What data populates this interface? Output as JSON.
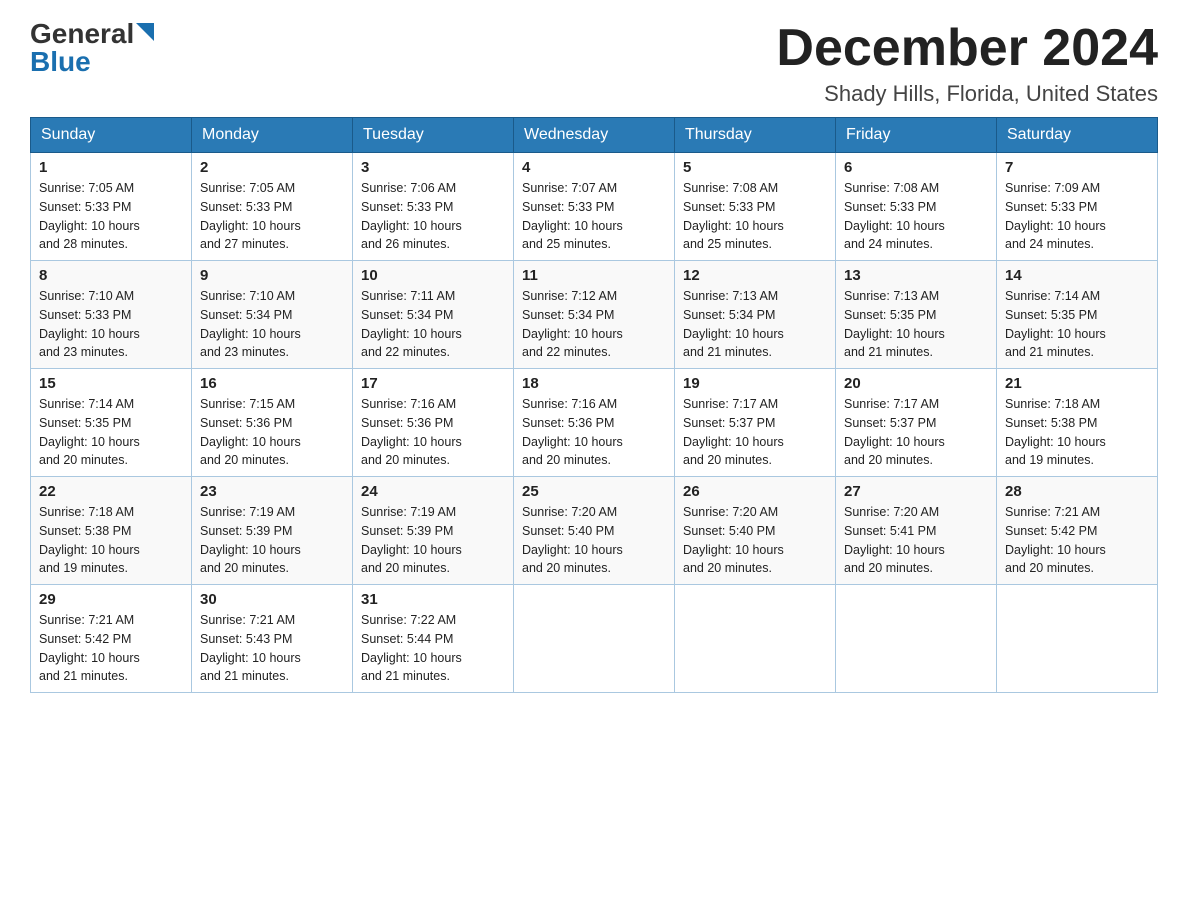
{
  "header": {
    "logo_general": "General",
    "logo_blue": "Blue",
    "month_title": "December 2024",
    "location": "Shady Hills, Florida, United States"
  },
  "days_of_week": [
    "Sunday",
    "Monday",
    "Tuesday",
    "Wednesday",
    "Thursday",
    "Friday",
    "Saturday"
  ],
  "weeks": [
    [
      {
        "day": "1",
        "sunrise": "7:05 AM",
        "sunset": "5:33 PM",
        "daylight": "10 hours and 28 minutes."
      },
      {
        "day": "2",
        "sunrise": "7:05 AM",
        "sunset": "5:33 PM",
        "daylight": "10 hours and 27 minutes."
      },
      {
        "day": "3",
        "sunrise": "7:06 AM",
        "sunset": "5:33 PM",
        "daylight": "10 hours and 26 minutes."
      },
      {
        "day": "4",
        "sunrise": "7:07 AM",
        "sunset": "5:33 PM",
        "daylight": "10 hours and 25 minutes."
      },
      {
        "day": "5",
        "sunrise": "7:08 AM",
        "sunset": "5:33 PM",
        "daylight": "10 hours and 25 minutes."
      },
      {
        "day": "6",
        "sunrise": "7:08 AM",
        "sunset": "5:33 PM",
        "daylight": "10 hours and 24 minutes."
      },
      {
        "day": "7",
        "sunrise": "7:09 AM",
        "sunset": "5:33 PM",
        "daylight": "10 hours and 24 minutes."
      }
    ],
    [
      {
        "day": "8",
        "sunrise": "7:10 AM",
        "sunset": "5:33 PM",
        "daylight": "10 hours and 23 minutes."
      },
      {
        "day": "9",
        "sunrise": "7:10 AM",
        "sunset": "5:34 PM",
        "daylight": "10 hours and 23 minutes."
      },
      {
        "day": "10",
        "sunrise": "7:11 AM",
        "sunset": "5:34 PM",
        "daylight": "10 hours and 22 minutes."
      },
      {
        "day": "11",
        "sunrise": "7:12 AM",
        "sunset": "5:34 PM",
        "daylight": "10 hours and 22 minutes."
      },
      {
        "day": "12",
        "sunrise": "7:13 AM",
        "sunset": "5:34 PM",
        "daylight": "10 hours and 21 minutes."
      },
      {
        "day": "13",
        "sunrise": "7:13 AM",
        "sunset": "5:35 PM",
        "daylight": "10 hours and 21 minutes."
      },
      {
        "day": "14",
        "sunrise": "7:14 AM",
        "sunset": "5:35 PM",
        "daylight": "10 hours and 21 minutes."
      }
    ],
    [
      {
        "day": "15",
        "sunrise": "7:14 AM",
        "sunset": "5:35 PM",
        "daylight": "10 hours and 20 minutes."
      },
      {
        "day": "16",
        "sunrise": "7:15 AM",
        "sunset": "5:36 PM",
        "daylight": "10 hours and 20 minutes."
      },
      {
        "day": "17",
        "sunrise": "7:16 AM",
        "sunset": "5:36 PM",
        "daylight": "10 hours and 20 minutes."
      },
      {
        "day": "18",
        "sunrise": "7:16 AM",
        "sunset": "5:36 PM",
        "daylight": "10 hours and 20 minutes."
      },
      {
        "day": "19",
        "sunrise": "7:17 AM",
        "sunset": "5:37 PM",
        "daylight": "10 hours and 20 minutes."
      },
      {
        "day": "20",
        "sunrise": "7:17 AM",
        "sunset": "5:37 PM",
        "daylight": "10 hours and 20 minutes."
      },
      {
        "day": "21",
        "sunrise": "7:18 AM",
        "sunset": "5:38 PM",
        "daylight": "10 hours and 19 minutes."
      }
    ],
    [
      {
        "day": "22",
        "sunrise": "7:18 AM",
        "sunset": "5:38 PM",
        "daylight": "10 hours and 19 minutes."
      },
      {
        "day": "23",
        "sunrise": "7:19 AM",
        "sunset": "5:39 PM",
        "daylight": "10 hours and 20 minutes."
      },
      {
        "day": "24",
        "sunrise": "7:19 AM",
        "sunset": "5:39 PM",
        "daylight": "10 hours and 20 minutes."
      },
      {
        "day": "25",
        "sunrise": "7:20 AM",
        "sunset": "5:40 PM",
        "daylight": "10 hours and 20 minutes."
      },
      {
        "day": "26",
        "sunrise": "7:20 AM",
        "sunset": "5:40 PM",
        "daylight": "10 hours and 20 minutes."
      },
      {
        "day": "27",
        "sunrise": "7:20 AM",
        "sunset": "5:41 PM",
        "daylight": "10 hours and 20 minutes."
      },
      {
        "day": "28",
        "sunrise": "7:21 AM",
        "sunset": "5:42 PM",
        "daylight": "10 hours and 20 minutes."
      }
    ],
    [
      {
        "day": "29",
        "sunrise": "7:21 AM",
        "sunset": "5:42 PM",
        "daylight": "10 hours and 21 minutes."
      },
      {
        "day": "30",
        "sunrise": "7:21 AM",
        "sunset": "5:43 PM",
        "daylight": "10 hours and 21 minutes."
      },
      {
        "day": "31",
        "sunrise": "7:22 AM",
        "sunset": "5:44 PM",
        "daylight": "10 hours and 21 minutes."
      },
      null,
      null,
      null,
      null
    ]
  ],
  "labels": {
    "sunrise": "Sunrise:",
    "sunset": "Sunset:",
    "daylight": "Daylight:"
  }
}
